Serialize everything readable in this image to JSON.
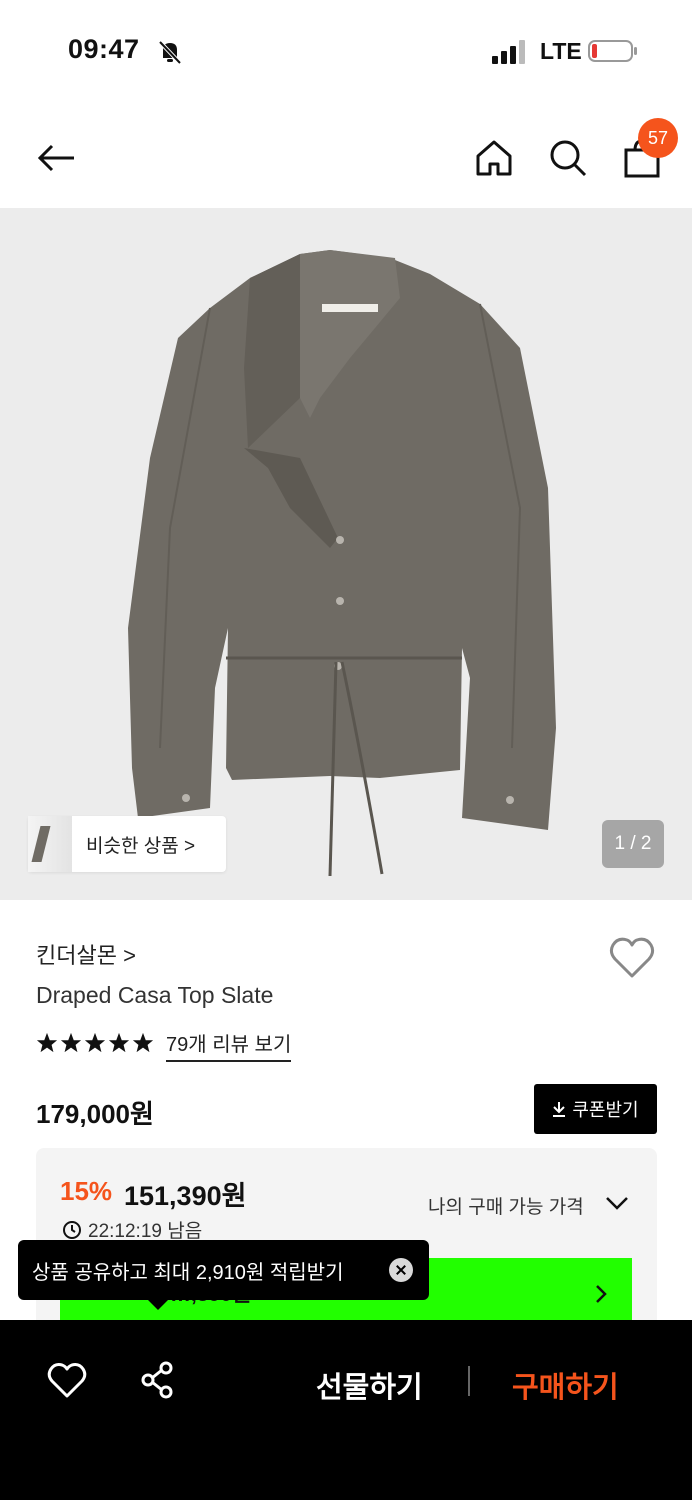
{
  "status": {
    "time": "09:47",
    "network": "LTE"
  },
  "header": {
    "cart_count": "57"
  },
  "gallery": {
    "similar_label": "비슷한 상품 >",
    "pager": "1 / 2"
  },
  "product": {
    "brand": "킨더살몬 >",
    "name": "Draped Casa Top Slate",
    "rating": 5,
    "reviews_label": "79개 리뷰 보기",
    "price": "179,000원",
    "coupon_label": "쿠폰받기"
  },
  "discount": {
    "percent": "15%",
    "price": "151,390원",
    "my_price_label": "나의 구매 가능 가격",
    "timer": "22:12:19 남음",
    "banner_partial": "…,390원"
  },
  "toast": {
    "text": "상품 공유하고 최대 2,910원 적립받기"
  },
  "bottom": {
    "gift_label": "선물하기",
    "buy_label": "구매하기"
  },
  "colors": {
    "accent": "#f5541c",
    "green": "#22ff00",
    "bar": "#000000"
  }
}
